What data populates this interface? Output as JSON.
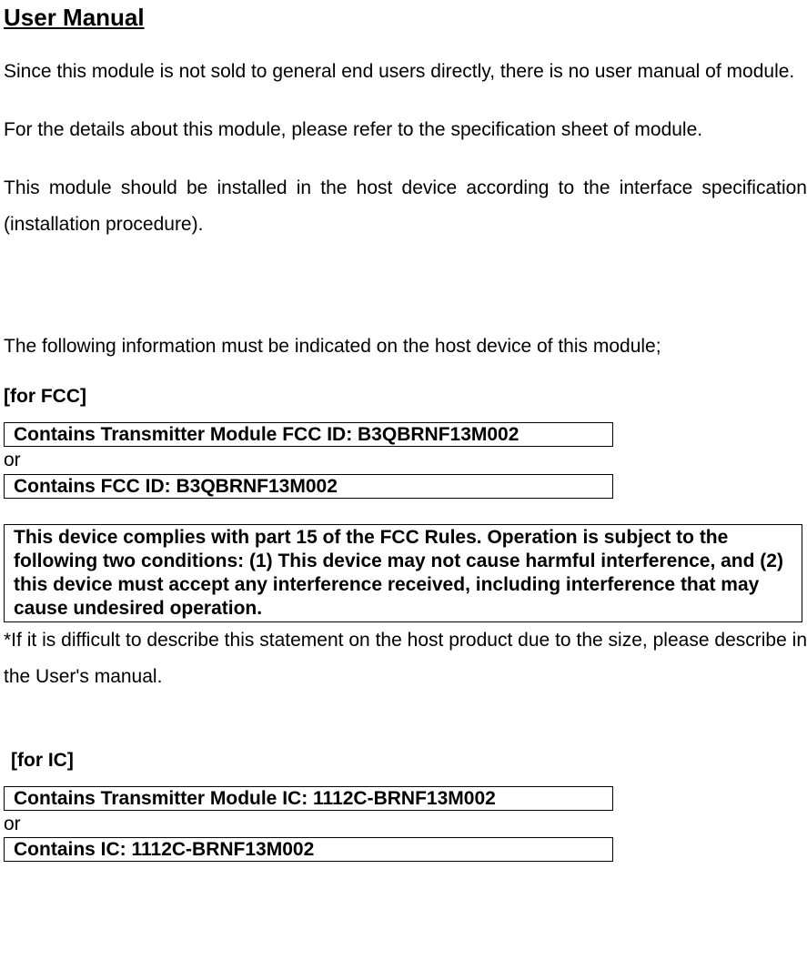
{
  "title": "User Manual",
  "paragraphs": {
    "p1": "Since this module is not sold to general end users directly, there is no user manual of module.",
    "p2": "For the details about this module, please refer to the specification sheet of module.",
    "p3": "This module should be installed in the host device according to the interface specification (installation procedure).",
    "p4": "The following information must be indicated on the host device of this module;"
  },
  "fcc": {
    "label": "[for FCC]",
    "box1": "Contains Transmitter Module FCC ID: B3QBRNF13M002",
    "or": "or",
    "box2": "Contains FCC ID: B3QBRNF13M002",
    "compliance": "This device complies with part 15 of the FCC Rules. Operation is subject to the following two conditions: (1) This device may not cause harmful interference, and (2) this device must accept any interference received, including interference that may cause undesired operation.",
    "note": "*If it is difficult to describe this statement on the host product due to the size, please describe in the User's manual."
  },
  "ic": {
    "label": "[for IC]",
    "box1": "Contains Transmitter Module IC: 1112C-BRNF13M002",
    "or": "or",
    "box2": "Contains IC: 1112C-BRNF13M002"
  }
}
